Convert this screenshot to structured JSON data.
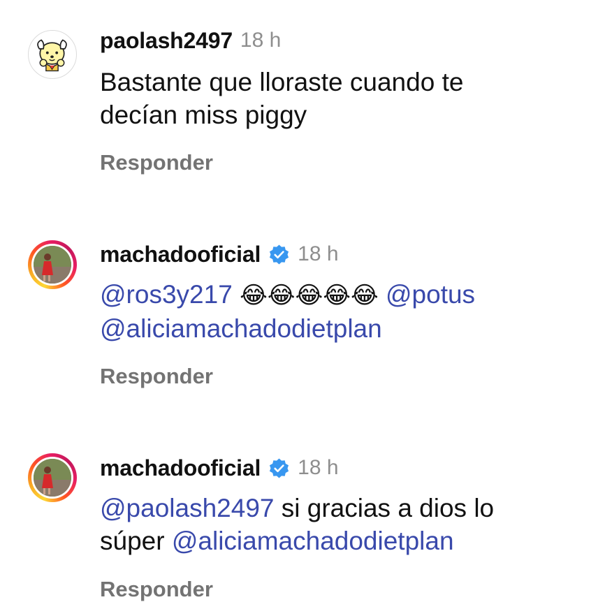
{
  "comments": [
    {
      "username": "paolash2497",
      "time": "18 h",
      "text_line1": "Bastante que lloraste cuando te",
      "text_line2": "decían miss piggy",
      "reply_label": "Responder"
    },
    {
      "username": "machadooficial",
      "time": "18 h",
      "mention1": "@ros3y217",
      "emojis": "😂😂😂😂😂",
      "mention2": "@potus",
      "mention3": "@aliciamachadodietplan",
      "reply_label": "Responder"
    },
    {
      "username": "machadooficial",
      "time": "18 h",
      "mention1": "@paolash2497",
      "text1": " si gracias a dios lo",
      "text2": "súper ",
      "mention2": "@aliciamachadodietplan",
      "reply_label": "Responder"
    }
  ],
  "colors": {
    "mention": "#3949ab",
    "muted": "#8e8e8e",
    "verified": "#3897f0"
  },
  "icons": [
    "cartoon-dog-avatar-icon",
    "verified-badge-icon"
  ]
}
